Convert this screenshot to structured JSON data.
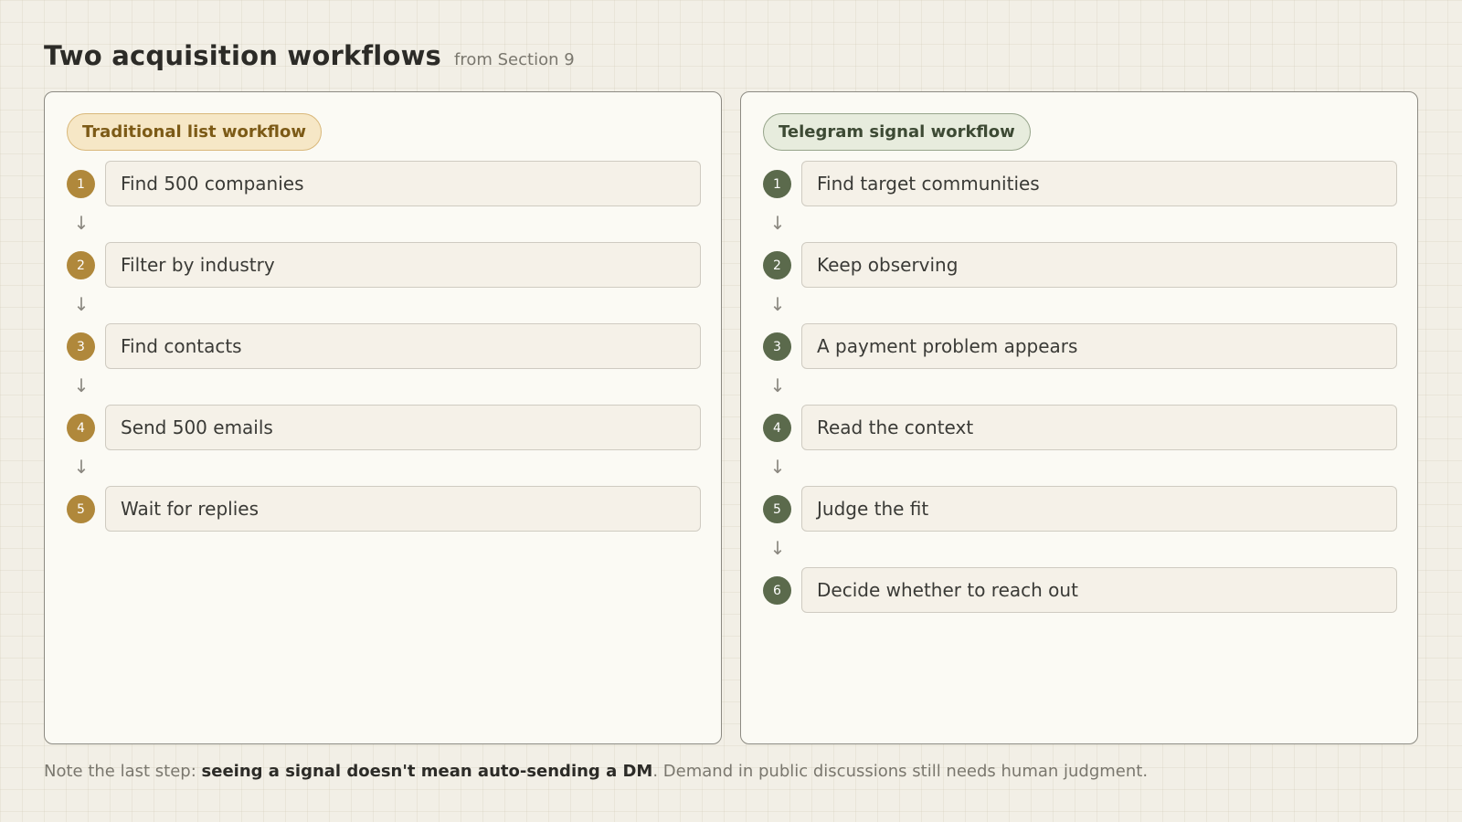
{
  "header": {
    "title": "Two acquisition workflows",
    "subtitle": "from Section 9"
  },
  "workflows": [
    {
      "label": "Traditional list workflow",
      "accent_color": "#b0883b",
      "steps": [
        {
          "number": "1",
          "text": "Find 500 companies"
        },
        {
          "number": "2",
          "text": "Filter by industry"
        },
        {
          "number": "3",
          "text": "Find contacts"
        },
        {
          "number": "4",
          "text": "Send 500 emails"
        },
        {
          "number": "5",
          "text": "Wait for replies"
        }
      ]
    },
    {
      "label": "Telegram signal workflow",
      "accent_color": "#5b6a4c",
      "steps": [
        {
          "number": "1",
          "text": "Find target communities"
        },
        {
          "number": "2",
          "text": "Keep observing"
        },
        {
          "number": "3",
          "text": "A payment problem appears"
        },
        {
          "number": "4",
          "text": "Read the context"
        },
        {
          "number": "5",
          "text": "Judge the fit"
        },
        {
          "number": "6",
          "text": "Decide whether to reach out"
        }
      ]
    }
  ],
  "arrow_glyph": "↓",
  "footnote": {
    "prefix": "Note the last step: ",
    "emphasis": "seeing a signal doesn't mean auto-sending a DM",
    "suffix": ". Demand in public discussions still needs human judgment."
  }
}
